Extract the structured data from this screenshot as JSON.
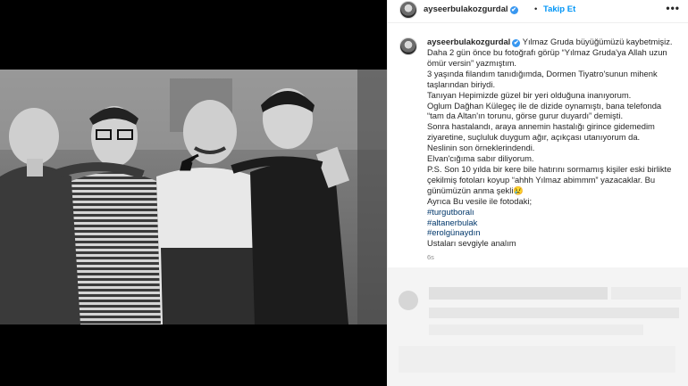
{
  "post": {
    "username": "ayseerbulakozgurdal",
    "verified_icon": "✔",
    "separator": "•",
    "follow_label": "Takip Et",
    "more_icon": "•••",
    "caption_lines": [
      "Yılmaz Gruda büyüğümüzü kaybetmişiz.",
      "Daha 2 gün önce bu fotoğrafı görüp “Yılmaz Gruda'ya Allah uzun",
      "ömür versin” yazmıştım.",
      "3 yaşında filandım tanıdığımda, Dormen Tiyatro'sunun mihenk",
      "taşlarından biriydi.",
      "Tanıyan Hepimizde güzel bir yeri olduğuna inanıyorum.",
      "Oglum Dağhan Külegeç ile de dizide oynamıştı, bana telefonda",
      "“tam da Altan'ın torunu, görse gurur duyardı” demişti.",
      "Sonra hastalandı, araya annemin hastalığı girince gidemedim",
      "ziyaretine, suçluluk duygum ağır, açıkçası utanıyorum da.",
      "Neslinin son örneklerindendi.",
      "Elvan'cığıma sabır diliyorum.",
      "P.S. Son 10 yılda bir kere bile hatırını sormamış kişiler eski birlikte",
      "çekilmiş fotoları koyup “ahhh Yılmaz abimmm” yazacaklar. Bu",
      "günümüzün anma şekli😢",
      "Ayrıca Bu vesile ile fotodaki;"
    ],
    "hashtags": [
      "#turgutboralı",
      "#altanerbulak",
      "#erolgünaydın"
    ],
    "closing": "Ustaları sevgiyle analım",
    "time": "6s"
  }
}
